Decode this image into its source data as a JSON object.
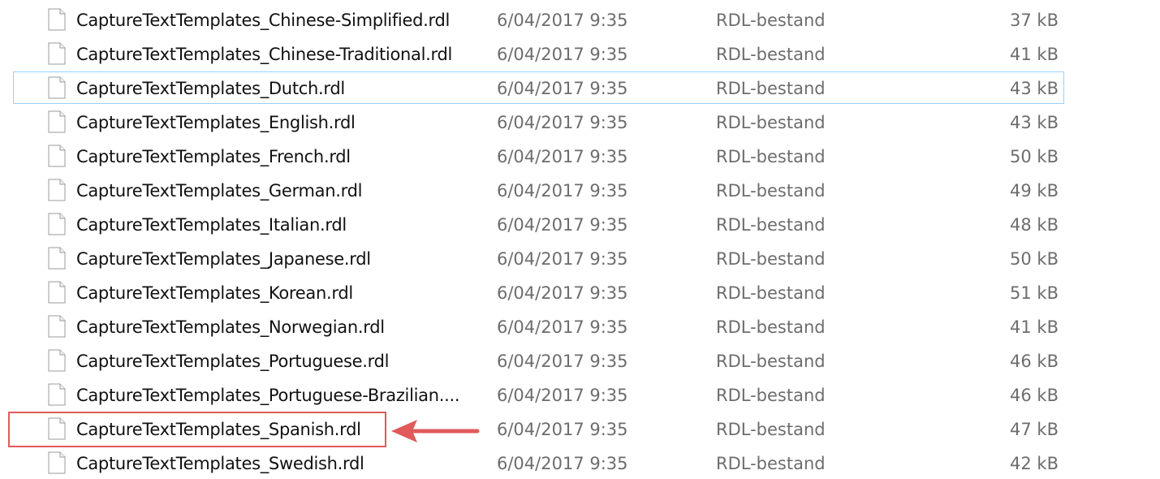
{
  "files": [
    {
      "name": "CaptureTextTemplates_Chinese-Simplified.rdl",
      "modified": "6/04/2017 9:35",
      "type": "RDL-bestand",
      "size": "37 kB"
    },
    {
      "name": "CaptureTextTemplates_Chinese-Traditional.rdl",
      "modified": "6/04/2017 9:35",
      "type": "RDL-bestand",
      "size": "41 kB"
    },
    {
      "name": "CaptureTextTemplates_Dutch.rdl",
      "modified": "6/04/2017 9:35",
      "type": "RDL-bestand",
      "size": "43 kB"
    },
    {
      "name": "CaptureTextTemplates_English.rdl",
      "modified": "6/04/2017 9:35",
      "type": "RDL-bestand",
      "size": "43 kB"
    },
    {
      "name": "CaptureTextTemplates_French.rdl",
      "modified": "6/04/2017 9:35",
      "type": "RDL-bestand",
      "size": "50 kB"
    },
    {
      "name": "CaptureTextTemplates_German.rdl",
      "modified": "6/04/2017 9:35",
      "type": "RDL-bestand",
      "size": "49 kB"
    },
    {
      "name": "CaptureTextTemplates_Italian.rdl",
      "modified": "6/04/2017 9:35",
      "type": "RDL-bestand",
      "size": "48 kB"
    },
    {
      "name": "CaptureTextTemplates_Japanese.rdl",
      "modified": "6/04/2017 9:35",
      "type": "RDL-bestand",
      "size": "50 kB"
    },
    {
      "name": "CaptureTextTemplates_Korean.rdl",
      "modified": "6/04/2017 9:35",
      "type": "RDL-bestand",
      "size": "51 kB"
    },
    {
      "name": "CaptureTextTemplates_Norwegian.rdl",
      "modified": "6/04/2017 9:35",
      "type": "RDL-bestand",
      "size": "41 kB"
    },
    {
      "name": "CaptureTextTemplates_Portuguese.rdl",
      "modified": "6/04/2017 9:35",
      "type": "RDL-bestand",
      "size": "46 kB"
    },
    {
      "name": "CaptureTextTemplates_Portuguese-Brazilian....",
      "modified": "6/04/2017 9:35",
      "type": "RDL-bestand",
      "size": "46 kB"
    },
    {
      "name": "CaptureTextTemplates_Spanish.rdl",
      "modified": "6/04/2017 9:35",
      "type": "RDL-bestand",
      "size": "47 kB"
    },
    {
      "name": "CaptureTextTemplates_Swedish.rdl",
      "modified": "6/04/2017 9:35",
      "type": "RDL-bestand",
      "size": "42 kB"
    }
  ],
  "focused_file": "CaptureTextTemplates_Dutch.rdl",
  "annotated_file": "CaptureTextTemplates_Spanish.rdl",
  "icons": {
    "file": "document-icon"
  },
  "colors": {
    "focus_border": "#99d1ff",
    "annotation": "#e05a5a",
    "name_text": "#111111",
    "detail_text": "#6d6d6d"
  }
}
